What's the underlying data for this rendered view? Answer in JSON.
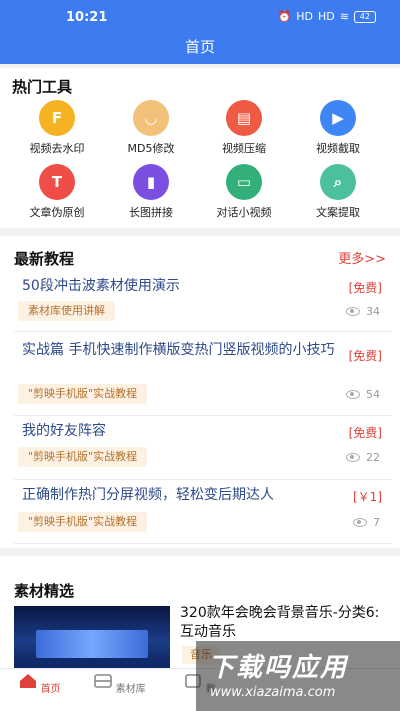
{
  "status_bar": {
    "time": "10:21",
    "battery": "42",
    "signal_a": "HD",
    "signal_b": "HD"
  },
  "header": {
    "title": "首页"
  },
  "colors": {
    "primary": "#3c7bf0",
    "accent": "#e0413a",
    "tag_bg": "#fdf1e4"
  },
  "tools": {
    "title": "热门工具",
    "items": [
      {
        "label": "视频去水印",
        "icon": "watermark-remove-icon",
        "color": "#f5b324",
        "glyph": "F"
      },
      {
        "label": "MD5修改",
        "icon": "md5-edit-icon",
        "color": "#f2c27a",
        "glyph": "◡"
      },
      {
        "label": "视频压缩",
        "icon": "compress-icon",
        "color": "#ee5a44",
        "glyph": "▤"
      },
      {
        "label": "视频截取",
        "icon": "video-cut-icon",
        "color": "#3f86f5",
        "glyph": "▶"
      },
      {
        "label": "文章伪原创",
        "icon": "article-icon",
        "color": "#ee4d48",
        "glyph": "T"
      },
      {
        "label": "长图拼接",
        "icon": "long-image-icon",
        "color": "#7b4fe0",
        "glyph": "▮"
      },
      {
        "label": "对话小视频",
        "icon": "dialogue-video-icon",
        "color": "#33b07a",
        "glyph": "▭"
      },
      {
        "label": "文案提取",
        "icon": "text-extract-icon",
        "color": "#4bbf9e",
        "glyph": "⌕"
      }
    ]
  },
  "tutorials": {
    "title": "最新教程",
    "more_label": "更多>>",
    "items": [
      {
        "title": "50段冲击波素材使用演示",
        "price": "[免费]",
        "tag": "素材库使用讲解",
        "views": "34"
      },
      {
        "title": "实战篇 手机快速制作横版变热门竖版视频的小技巧",
        "price": "[免费]",
        "tag": "\"剪映手机版\"实战教程",
        "views": "54"
      },
      {
        "title": "我的好友阵容",
        "price": "[免费]",
        "tag": "\"剪映手机版\"实战教程",
        "views": "22"
      },
      {
        "title": "正确制作热门分屏视频，轻松变后期达人",
        "price": "[￥1]",
        "tag": "\"剪映手机版\"实战教程",
        "views": "7"
      }
    ]
  },
  "materials": {
    "title": "素材精选",
    "items": [
      {
        "title": "320款年会晚会背景音乐-分类6: 互动音乐",
        "tag": "音乐"
      }
    ]
  },
  "tabbar": {
    "items": [
      {
        "label": "首页",
        "icon": "home-icon",
        "active": true
      },
      {
        "label": "素材库",
        "icon": "material-library-icon",
        "active": false
      },
      {
        "label": "教",
        "icon": "tutorial-icon",
        "active": false
      },
      {
        "label": "",
        "icon": "tab-icon",
        "active": false
      },
      {
        "label": "",
        "icon": "profile-icon",
        "active": false
      }
    ]
  },
  "watermark": {
    "main": "下载吗应用",
    "url": "www.xiazaima.com"
  }
}
